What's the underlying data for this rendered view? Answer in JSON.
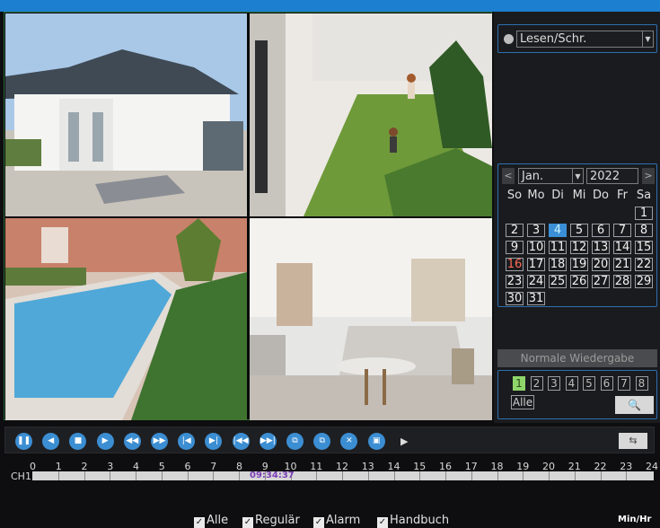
{
  "side": {
    "mode": "Lesen/Schr.",
    "month": "Jan.",
    "year": "2022",
    "prev": "<",
    "next": ">",
    "weekdays": [
      "So",
      "Mo",
      "Di",
      "Mi",
      "Do",
      "Fr",
      "Sa"
    ],
    "days": [
      "1",
      "2",
      "3",
      "4",
      "5",
      "6",
      "7",
      "8",
      "9",
      "10",
      "11",
      "12",
      "13",
      "14",
      "15",
      "16",
      "17",
      "18",
      "19",
      "20",
      "21",
      "22",
      "23",
      "24",
      "25",
      "26",
      "27",
      "28",
      "29",
      "30",
      "31"
    ],
    "selected_day": "4",
    "today_day": "16",
    "play_mode": "Normale Wiedergabe",
    "channels": [
      "1",
      "2",
      "3",
      "4",
      "5",
      "6",
      "7",
      "8"
    ],
    "all_label": "Alle",
    "search_icon": "🔍"
  },
  "timeline": {
    "ticks": [
      "0",
      "1",
      "2",
      "3",
      "4",
      "5",
      "6",
      "7",
      "8",
      "9",
      "10",
      "11",
      "12",
      "13",
      "14",
      "15",
      "16",
      "17",
      "18",
      "19",
      "20",
      "21",
      "22",
      "23",
      "24"
    ],
    "channel": "CH1",
    "cursor_time": "09:34:37"
  },
  "filters": {
    "all": "Alle",
    "regular": "Regulär",
    "alarm": "Alarm",
    "manual": "Handbuch"
  },
  "scale": "Min/Hr",
  "colors": {
    "accent": "#3c8ed3",
    "selected_day": "#3a8fd6",
    "today_day": "#ff6b55",
    "active_channel": "#8fd66a"
  }
}
